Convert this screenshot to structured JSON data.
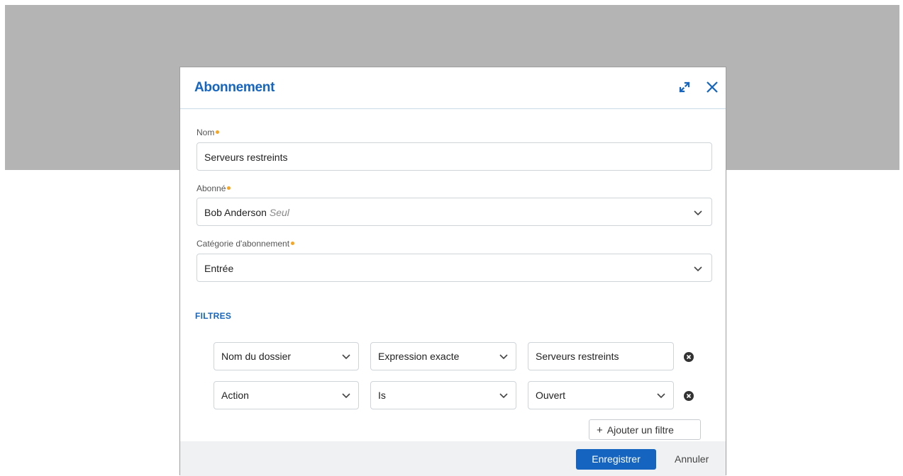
{
  "dialog": {
    "title": "Abonnement",
    "expand_icon": "expand-icon",
    "close_icon": "close-icon"
  },
  "form": {
    "name": {
      "label": "Nom",
      "value": "Serveurs restreints"
    },
    "subscriber": {
      "label": "Abonné",
      "value": "Bob Anderson",
      "qualifier": "Seul"
    },
    "category": {
      "label": "Catégorie d'abonnement",
      "value": "Entrée"
    }
  },
  "filters": {
    "title": "FILTRES",
    "rows": [
      {
        "field": "Nom du dossier",
        "operator": "Expression exacte",
        "value": "Serveurs restreints",
        "value_is_select": false
      },
      {
        "field": "Action",
        "operator": "Is",
        "value": "Ouvert",
        "value_is_select": true
      }
    ],
    "add_label": "Ajouter un filtre"
  },
  "footer": {
    "save_label": "Enregistrer",
    "cancel_label": "Annuler"
  },
  "colors": {
    "accent": "#1565c0",
    "required_dot": "#f5a623",
    "backdrop": "#b4b4b4",
    "footer_bg": "#f0f1f3"
  }
}
